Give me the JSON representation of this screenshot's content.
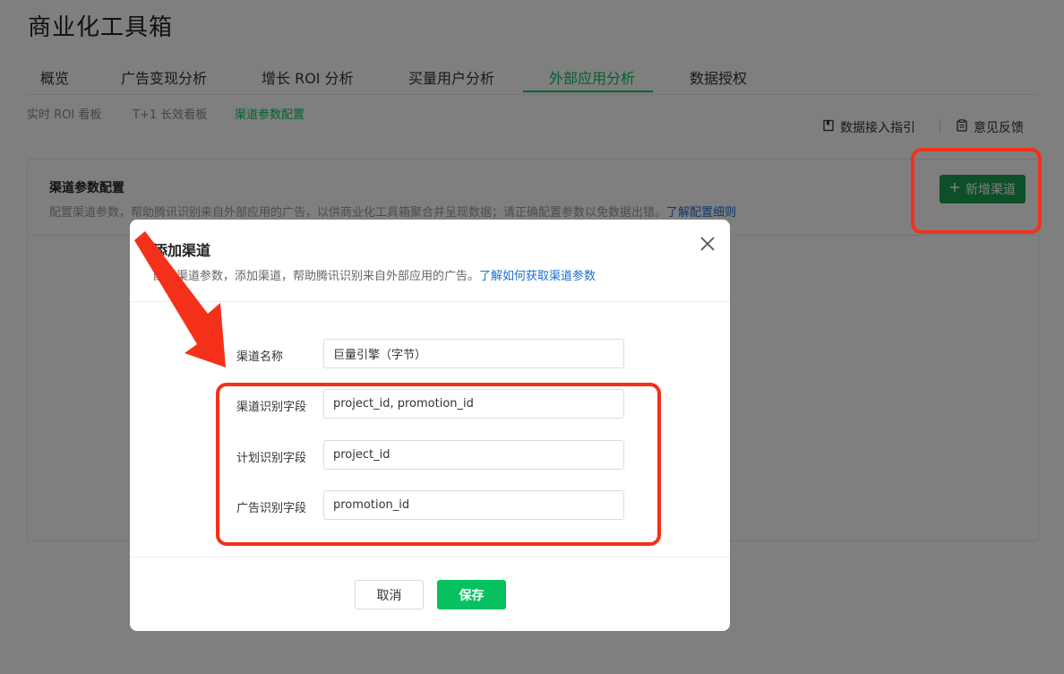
{
  "app": {
    "title": "商业化工具箱"
  },
  "main_tabs": [
    {
      "label": "概览"
    },
    {
      "label": "广告变现分析"
    },
    {
      "label": "增长 ROI 分析"
    },
    {
      "label": "买量用户分析"
    },
    {
      "label": "外部应用分析",
      "active": true
    },
    {
      "label": "数据授权"
    }
  ],
  "sub_tabs": [
    {
      "label": "实时 ROI 看板"
    },
    {
      "label": "T+1 长效看板"
    },
    {
      "label": "渠道参数配置",
      "active": true
    }
  ],
  "toolbar": {
    "guide_label": "数据接入指引",
    "guide_icon": "bookmark-icon",
    "feedback_label": "意见反馈",
    "feedback_icon": "clipboard-icon"
  },
  "panel": {
    "title": "渠道参数配置",
    "desc": "配置渠道参数，帮助腾讯识别来自外部应用的广告，以供商业化工具箱聚合并呈现数据；请正确配置参数以免数据出错。",
    "desc_link": "了解配置细则",
    "add_button_label": "新增渠道",
    "add_button_icon": "plus-icon"
  },
  "modal": {
    "title": "添加渠道",
    "desc": "配置渠道参数，添加渠道，帮助腾讯识别来自外部应用的广告。",
    "desc_link": "了解如何获取渠道参数",
    "close_icon": "close-icon",
    "fields": [
      {
        "label": "渠道名称",
        "value": "巨量引擎（字节）"
      },
      {
        "label": "渠道识别字段",
        "value": "project_id, promotion_id"
      },
      {
        "label": "计划识别字段",
        "value": "project_id"
      },
      {
        "label": "广告识别字段",
        "value": "promotion_id"
      }
    ],
    "cancel_label": "取消",
    "save_label": "保存"
  },
  "colors": {
    "accent": "#07c160",
    "primary_button": "#1a9f52",
    "link": "#1a6fd1",
    "annotation": "#f5301a",
    "overlay": "rgba(0,0,0,0.5)"
  }
}
